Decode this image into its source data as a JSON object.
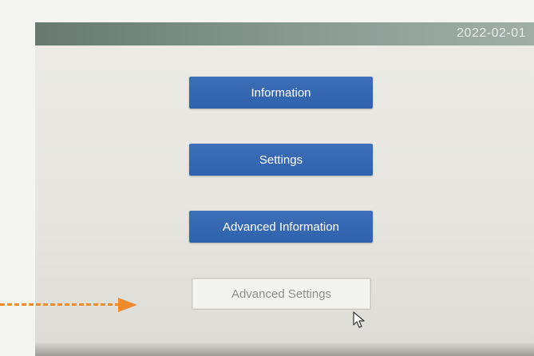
{
  "header": {
    "date": "2022-02-01"
  },
  "menu": {
    "information": "Information",
    "settings": "Settings",
    "advanced_information": "Advanced Information",
    "advanced_settings": "Advanced Settings"
  },
  "colors": {
    "button_blue": "#3068b2",
    "button_light": "#f3f3ef",
    "annotation_arrow": "#ef8a2d"
  },
  "icons": {
    "pointer": "mouse-pointer-icon",
    "annotation": "dashed-arrow-icon"
  }
}
